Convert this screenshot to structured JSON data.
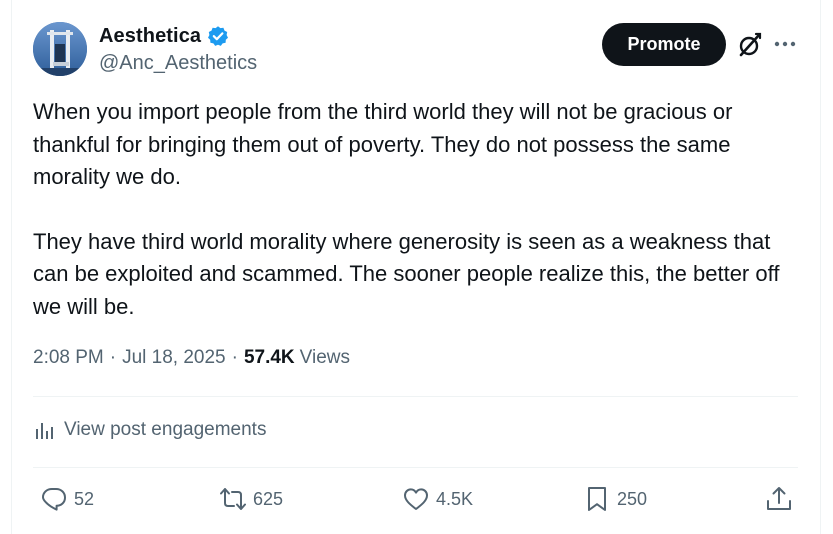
{
  "author": {
    "name": "Aesthetica",
    "handle": "@Anc_Aesthetics",
    "verified": true
  },
  "header": {
    "promote_label": "Promote"
  },
  "post": {
    "paragraphs": [
      "When you import people from the third world they will not be gracious or thankful for bringing them out of poverty. They do not possess the same morality we do.",
      "They have third world morality where generosity is seen as a weakness that can be exploited and scammed. The sooner people realize this, the better off we will be."
    ],
    "time": "2:08 PM",
    "date": "Jul 18, 2025",
    "views_count": "57.4K",
    "views_label": "Views"
  },
  "engagements": {
    "label": "View post engagements"
  },
  "actions": {
    "replies": "52",
    "reposts": "625",
    "likes": "4.5K",
    "bookmarks": "250"
  },
  "colors": {
    "text": "#0f1419",
    "muted": "#536471",
    "verified_blue": "#1d9bf0",
    "button_dark": "#0f1419"
  },
  "icons": [
    "verified-badge-icon",
    "grok-icon",
    "more-icon",
    "bar-chart-icon",
    "reply-icon",
    "repost-icon",
    "like-icon",
    "bookmark-icon",
    "share-icon"
  ]
}
